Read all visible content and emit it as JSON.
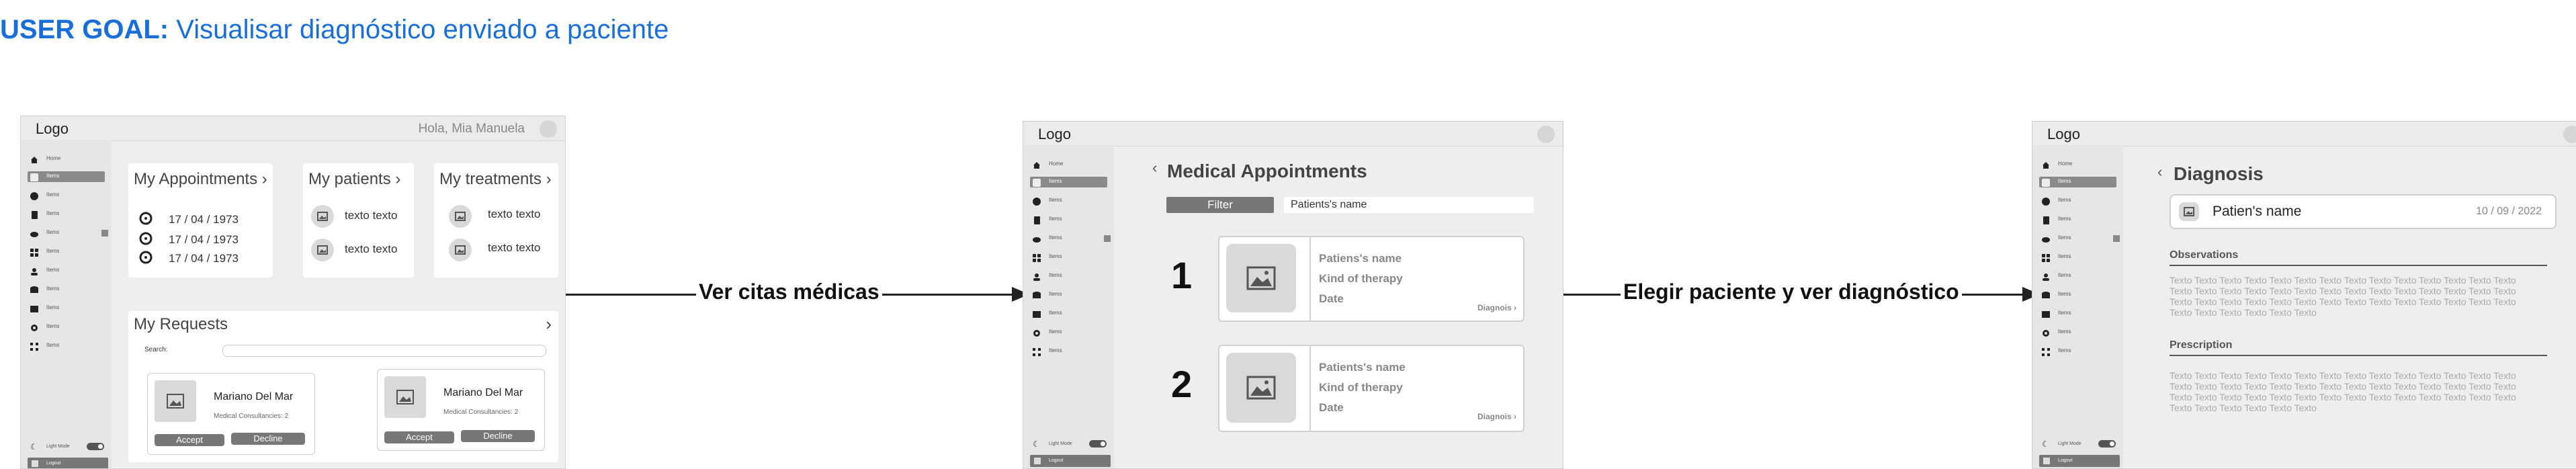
{
  "goal": {
    "prefix": "USER GOAL:",
    "text": "Visualisar diagnóstico enviado a paciente"
  },
  "screen1": {
    "logo": "Logo",
    "greeting": "Hola, Mia Manuela",
    "appointments": {
      "title": "My Appointments ›",
      "dates": [
        "17 / 04 / 1973",
        "17 / 04 / 1973",
        "17 / 04 / 1973"
      ]
    },
    "patients": {
      "title": "My patients ›",
      "items": [
        "texto texto",
        "texto texto"
      ]
    },
    "treatments": {
      "title": "My treatments ›",
      "items": [
        "texto texto",
        "texto texto"
      ]
    },
    "requests": {
      "title": "My Requests",
      "chevron": "›",
      "search_label": "Search:",
      "cards": [
        {
          "name": "Mariano Del Mar",
          "sub": "Medical Consultancies: 2",
          "accept": "Accept",
          "decline": "Decline"
        },
        {
          "name": "Mariano Del Mar",
          "sub": "Medical Consultancies: 2",
          "accept": "Accept",
          "decline": "Decline"
        }
      ]
    },
    "light_mode": "Light Mode",
    "logout": "Logout"
  },
  "arrow1": {
    "label": "Ver citas médicas"
  },
  "screen2": {
    "logo": "Logo",
    "title": "Medical Appointments",
    "back": "‹",
    "filter_button": "Filter",
    "filter_placeholder": "Patients's name",
    "items": [
      {
        "number": "1",
        "name": "Patiens's name",
        "therapy": "Kind of therapy",
        "date": "Date",
        "link": "Diagnois ›"
      },
      {
        "number": "2",
        "name": "Patients's name",
        "therapy": "Kind of therapy",
        "date": "Date",
        "link": "Diagnois ›"
      }
    ],
    "light_mode": "Light Mode",
    "logout": "Logout"
  },
  "arrow2": {
    "label": "Elegir paciente y ver diagnóstico"
  },
  "screen3": {
    "logo": "Logo",
    "back": "‹",
    "title": "Diagnosis",
    "patient_name": "Patien's name",
    "date": "10 / 09 / 2022",
    "observations_title": "Observations",
    "observations_text": "Texto Texto Texto Texto Texto Texto Texto Texto Texto Texto Texto Texto Texto Texto Texto Texto Texto Texto Texto Texto Texto Texto Texto Texto Texto Texto Texto Texto Texto Texto Texto Texto Texto Texto Texto Texto Texto Texto Texto Texto Texto Texto Texto Texto Texto Texto Texto Texto",
    "prescription_title": "Prescription",
    "prescription_text": "Texto Texto Texto Texto Texto Texto Texto Texto Texto Texto Texto Texto Texto Texto Texto Texto Texto Texto Texto Texto Texto Texto Texto Texto Texto Texto Texto Texto Texto Texto Texto Texto Texto Texto Texto Texto Texto Texto Texto Texto Texto Texto Texto Texto Texto Texto Texto Texto",
    "light_mode": "Light Mode",
    "logout": "Logout"
  },
  "sidebar_labels": [
    "Home",
    "Items",
    "Items",
    "Items",
    "Items",
    "Items",
    "Items",
    "Items",
    "Items",
    "Items",
    "Items"
  ]
}
